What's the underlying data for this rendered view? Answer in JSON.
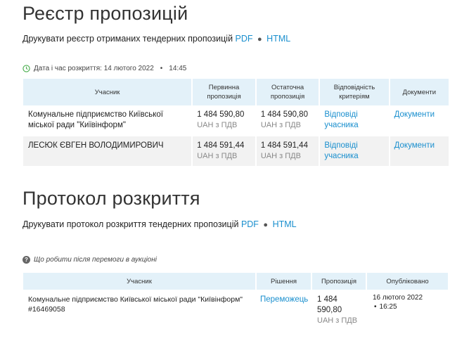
{
  "registry": {
    "title": "Реєстр пропозицій",
    "print_label": "Друкувати реєстр отриманих тендерних пропозицій",
    "pdf": "PDF",
    "html": "HTML",
    "opened_label": "Дата і час розкриття: 14 лютого 2022",
    "opened_time": "14:45",
    "columns": [
      "Учасник",
      "Первинна пропозиція",
      "Остаточна пропозиція",
      "Відповідність критеріям",
      "Документи"
    ],
    "rows": [
      {
        "participant": "Комунальне підприємство Київської міської ради \"Київінформ\"",
        "initial": "1 484 590,80",
        "initial_unit": "UAH з ПДВ",
        "final": "1 484 590,80",
        "final_unit": "UAH з ПДВ",
        "criteria": "Відповіді учасника",
        "docs": "Документи"
      },
      {
        "participant": "ЛЕСЮК ЄВГЕН ВОЛОДИМИРОВИЧ",
        "initial": "1 484 591,44",
        "initial_unit": "UAH з ПДВ",
        "final": "1 484 591,44",
        "final_unit": "UAH з ПДВ",
        "criteria": "Відповіді учасника",
        "docs": "Документи"
      }
    ]
  },
  "protocol": {
    "title": "Протокол розкриття",
    "print_label": "Друкувати протокол розкриття тендерних пропозицій",
    "pdf": "PDF",
    "html": "HTML",
    "help_link": "Що робити після перемоги в аукціоні",
    "columns": [
      "Учасник",
      "Рішення",
      "Пропозиція",
      "Опубліковано"
    ],
    "row": {
      "participant": "Комунальне підприємство Київської міської ради \"Київінформ\"",
      "code": "#16469058",
      "decision": "Переможець",
      "offer": "1 484 590,80",
      "offer_unit": "UAH з ПДВ",
      "published_date": "16 лютого 2022",
      "published_time": "16:25"
    }
  },
  "colors": {
    "link": "#1a8fce",
    "header_bg": "#e3f1f9",
    "row_alt": "#f2f2f2",
    "clock": "#4caf50"
  }
}
